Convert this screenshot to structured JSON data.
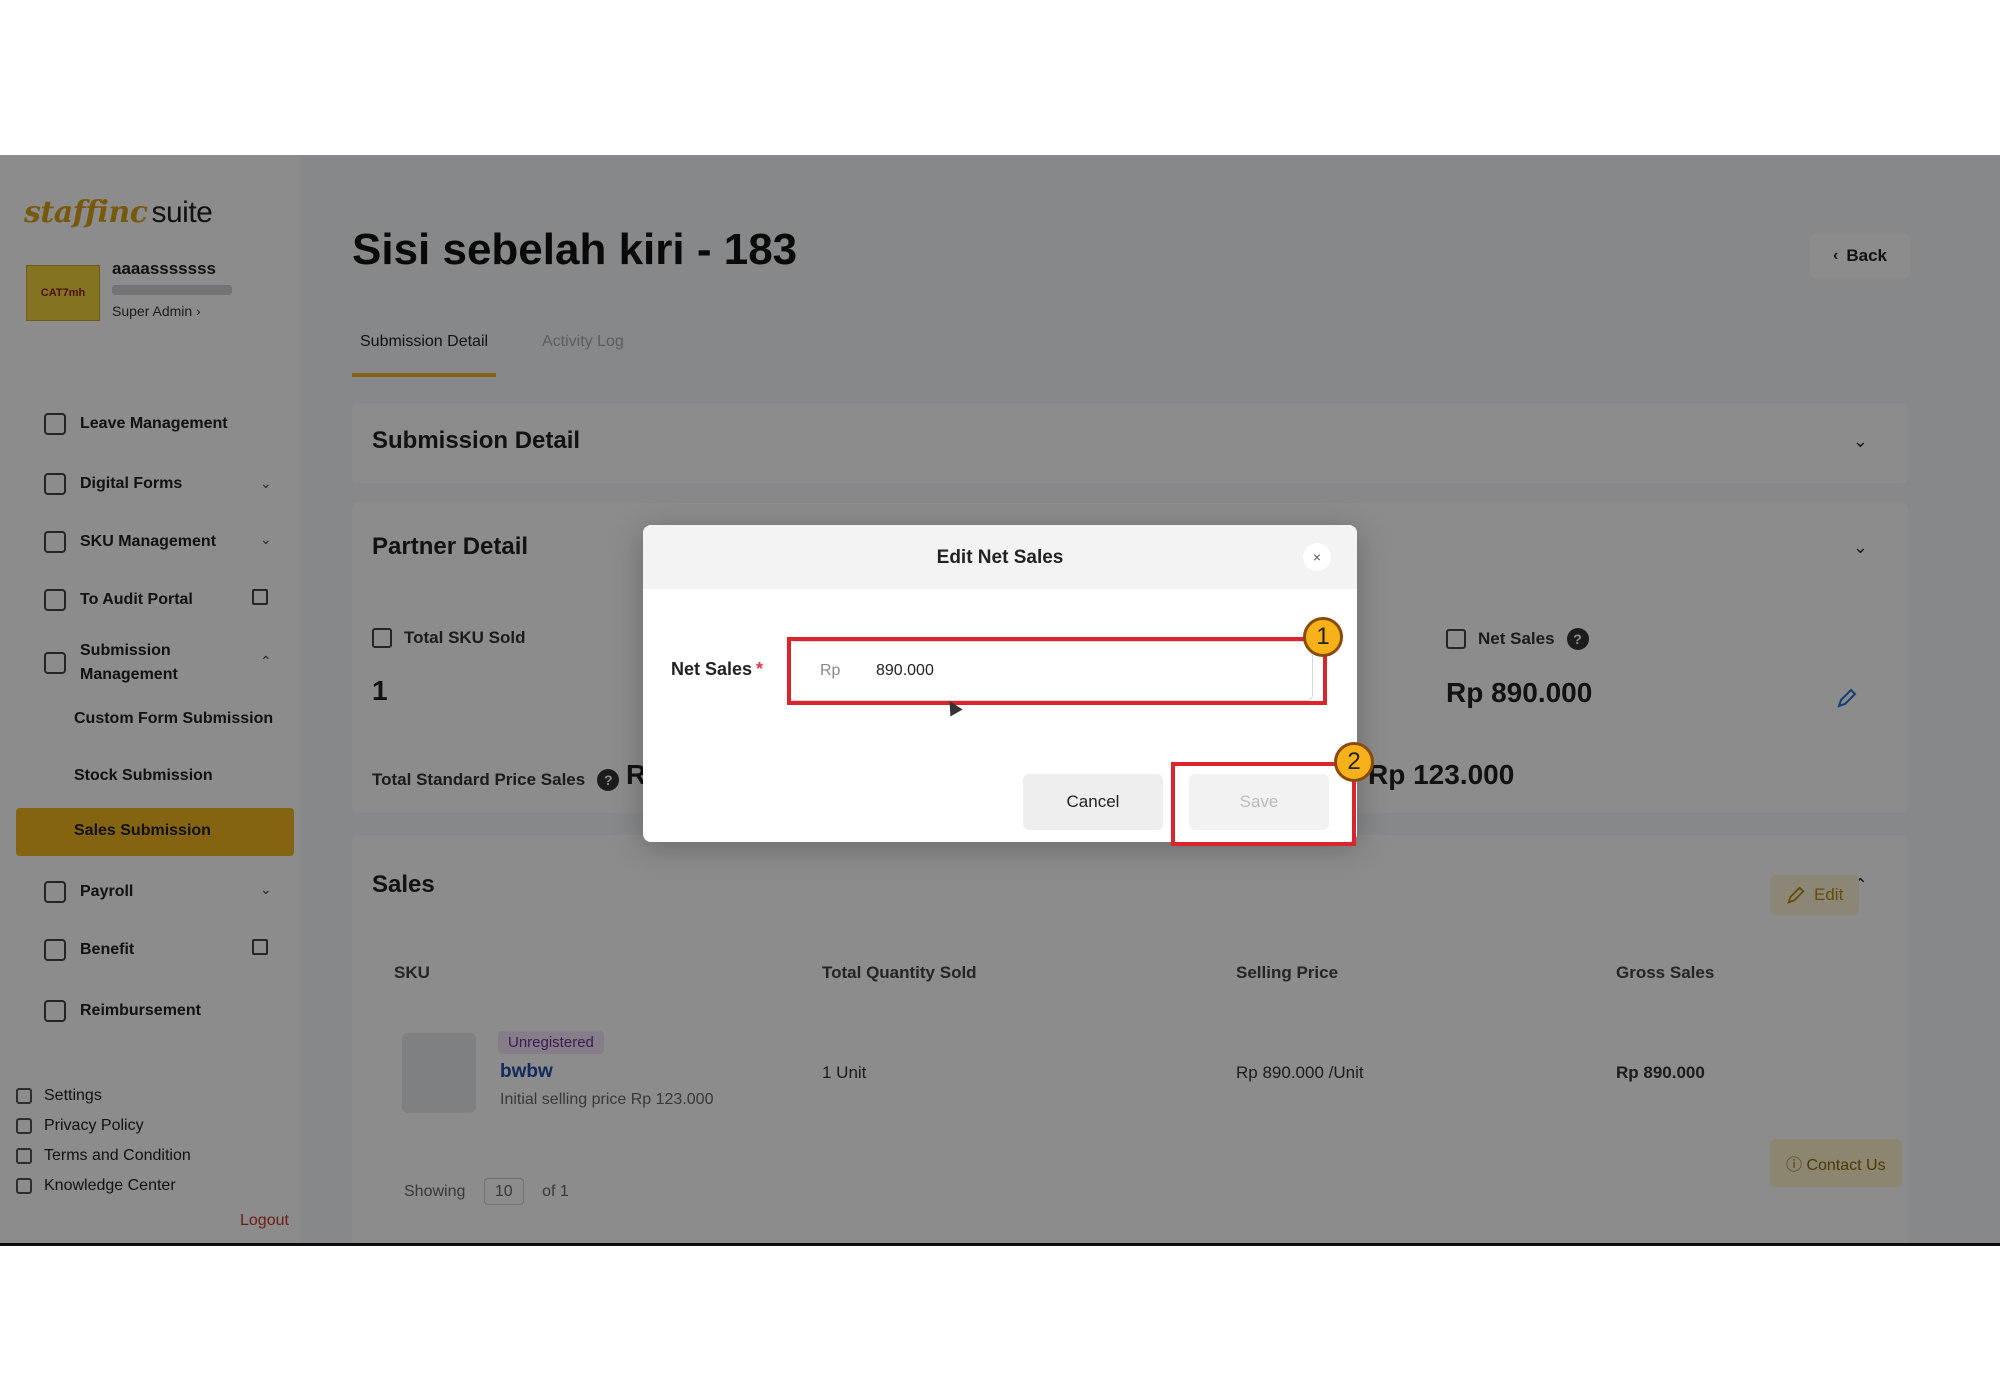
{
  "app": {
    "logo_brand": "staffinc",
    "logo_suffix": "suite",
    "user": {
      "name": "aaaasssssss",
      "role": "Super Admin ›",
      "avatar_text": "CAT7mh"
    }
  },
  "sidebar": {
    "items": [
      {
        "label": "Leave Management"
      },
      {
        "label": "Digital Forms",
        "chevron": "⌄"
      },
      {
        "label": "SKU Management",
        "chevron": "⌄"
      },
      {
        "label": "To Audit Portal"
      },
      {
        "label": "Submission Management",
        "chevron": "⌃"
      },
      {
        "label": "Payroll",
        "chevron": "⌄"
      },
      {
        "label": "Benefit"
      },
      {
        "label": "Reimbursement"
      }
    ],
    "subitems": [
      {
        "label": "Custom Form Submission"
      },
      {
        "label": "Stock Submission"
      },
      {
        "label": "Sales Submission"
      }
    ],
    "footer": [
      {
        "label": "Settings"
      },
      {
        "label": "Privacy Policy"
      },
      {
        "label": "Terms and Condition"
      },
      {
        "label": "Knowledge Center"
      }
    ],
    "logout": "Logout"
  },
  "main": {
    "title": "Sisi sebelah kiri - 183",
    "back": "Back",
    "tabs": [
      {
        "label": "Submission Detail"
      },
      {
        "label": "Activity Log"
      }
    ],
    "sections": {
      "submission_detail": "Submission Detail",
      "partner_detail": "Partner Detail",
      "sales": "Sales"
    },
    "stats": {
      "total_sku_sold_label": "Total SKU Sold",
      "total_sku_sold_value": "1",
      "net_sales_label": "Net Sales",
      "net_sales_value": "Rp 890.000",
      "total_standard_label": "Total Standard Price Sales",
      "total_standard_value_partial": "R",
      "standard_value": "Rp 123.000",
      "help": "?"
    },
    "edit": "Edit",
    "table": {
      "headers": [
        "SKU",
        "Total Quantity Sold",
        "Selling Price",
        "Gross Sales"
      ],
      "row": {
        "badge": "Unregistered",
        "sku": "bwbw",
        "sub": "Initial selling price Rp 123.000",
        "qty": "1 Unit",
        "price": "Rp 890.000 /Unit",
        "gross": "Rp 890.000"
      }
    },
    "pagination": {
      "showing": "Showing",
      "size": "10",
      "of": "of 1"
    },
    "contact": "Contact Us"
  },
  "modal": {
    "title": "Edit Net Sales",
    "close": "×",
    "label": "Net Sales",
    "required": "*",
    "prefix": "Rp",
    "value": "890.000",
    "cancel": "Cancel",
    "save": "Save"
  },
  "annotations": {
    "marker1": "1",
    "marker2": "2",
    "highlight_color": "#d9252b",
    "marker_color": "#f7b21a"
  },
  "colors": {
    "accent": "#f0b41f",
    "link": "#1f4ea8",
    "required": "#e0384b"
  }
}
